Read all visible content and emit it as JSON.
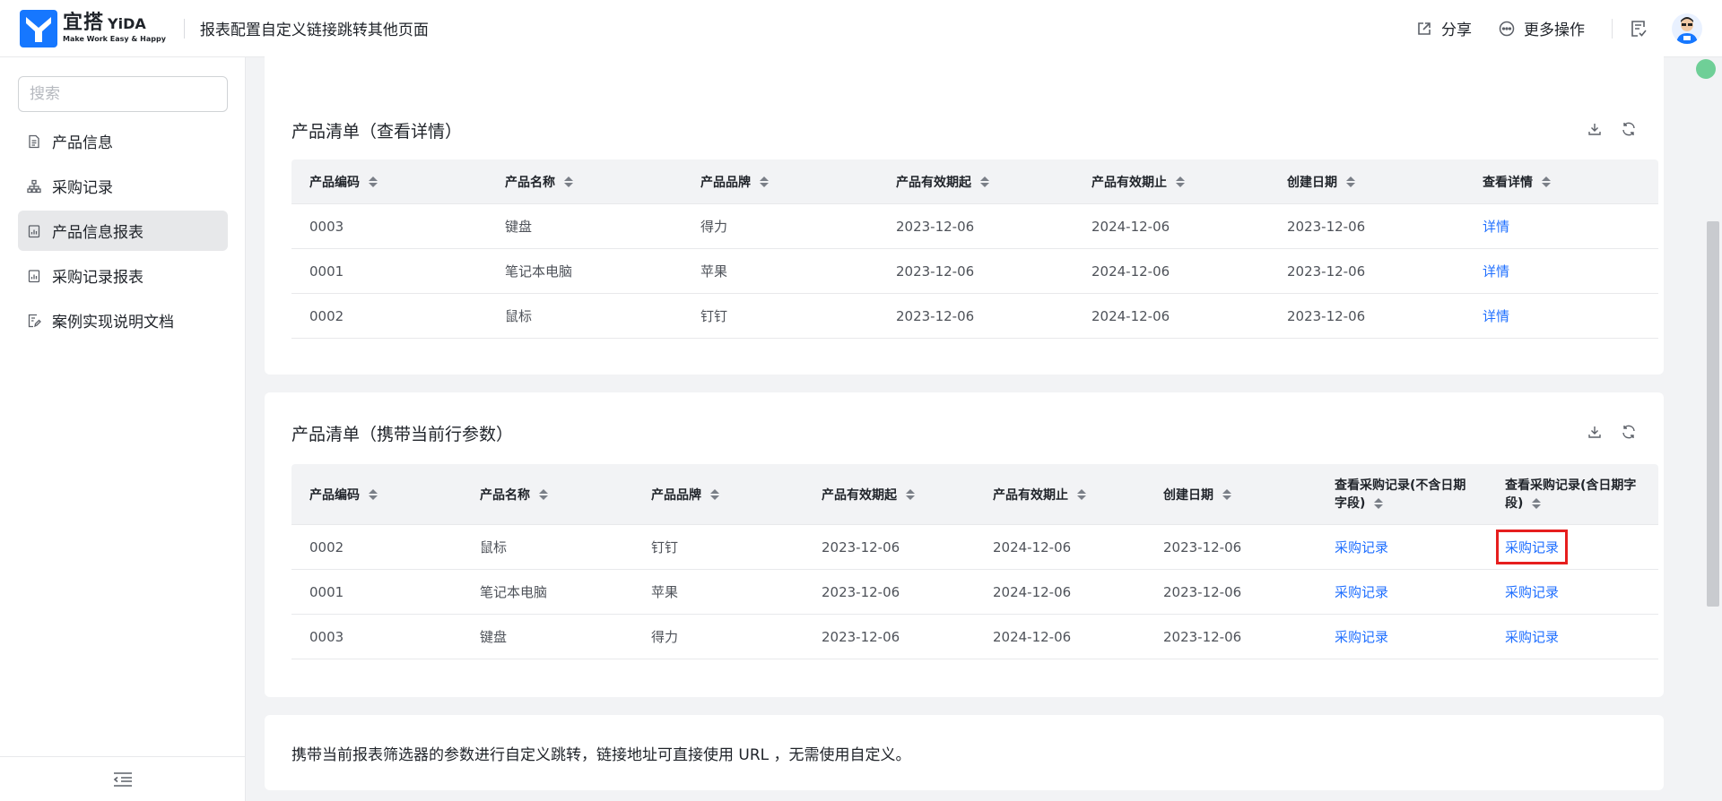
{
  "brand": {
    "name_cn": "宜搭",
    "name_en": "YiDA",
    "slogan": "Make Work Easy & Happy",
    "color": "#1677ff"
  },
  "header": {
    "page_title": "报表配置自定义链接跳转其他页面",
    "share_label": "分享",
    "more_label": "更多操作",
    "share_icon": "share-icon",
    "more_icon": "more-icon",
    "task_icon": "task-icon"
  },
  "sidebar": {
    "search_placeholder": "搜索",
    "items": [
      {
        "label": "产品信息",
        "icon": "form-icon",
        "active": false
      },
      {
        "label": "采购记录",
        "icon": "org-icon",
        "active": false
      },
      {
        "label": "产品信息报表",
        "icon": "report-icon",
        "active": true
      },
      {
        "label": "采购记录报表",
        "icon": "report-icon",
        "active": false
      },
      {
        "label": "案例实现说明文档",
        "icon": "doc-edit-icon",
        "active": false
      }
    ]
  },
  "table1": {
    "title": "产品清单（查看详情）",
    "columns": [
      "产品编码",
      "产品名称",
      "产品品牌",
      "产品有效期起",
      "产品有效期止",
      "创建日期",
      "查看详情"
    ],
    "rows": [
      [
        "0003",
        "键盘",
        "得力",
        "2023-12-06",
        "2024-12-06",
        "2023-12-06",
        "详情"
      ],
      [
        "0001",
        "笔记本电脑",
        "苹果",
        "2023-12-06",
        "2024-12-06",
        "2023-12-06",
        "详情"
      ],
      [
        "0002",
        "鼠标",
        "钉钉",
        "2023-12-06",
        "2024-12-06",
        "2023-12-06",
        "详情"
      ]
    ]
  },
  "table2": {
    "title": "产品清单（携带当前行参数）",
    "columns": [
      "产品编码",
      "产品名称",
      "产品品牌",
      "产品有效期起",
      "产品有效期止",
      "创建日期",
      "查看采购记录(不含日期字段)",
      "查看采购记录(含日期字段)"
    ],
    "rows": [
      [
        "0002",
        "鼠标",
        "钉钉",
        "2023-12-06",
        "2024-12-06",
        "2023-12-06",
        "采购记录",
        "采购记录"
      ],
      [
        "0001",
        "笔记本电脑",
        "苹果",
        "2023-12-06",
        "2024-12-06",
        "2023-12-06",
        "采购记录",
        "采购记录"
      ],
      [
        "0003",
        "键盘",
        "得力",
        "2023-12-06",
        "2024-12-06",
        "2023-12-06",
        "采购记录",
        "采购记录"
      ]
    ]
  },
  "note": {
    "text": "携带当前报表筛选器的参数进行自定义跳转，链接地址可直接使用 URL ，无需使用自定义。"
  },
  "colors": {
    "link": "#1f6fff",
    "highlight": "#e61e1e"
  }
}
